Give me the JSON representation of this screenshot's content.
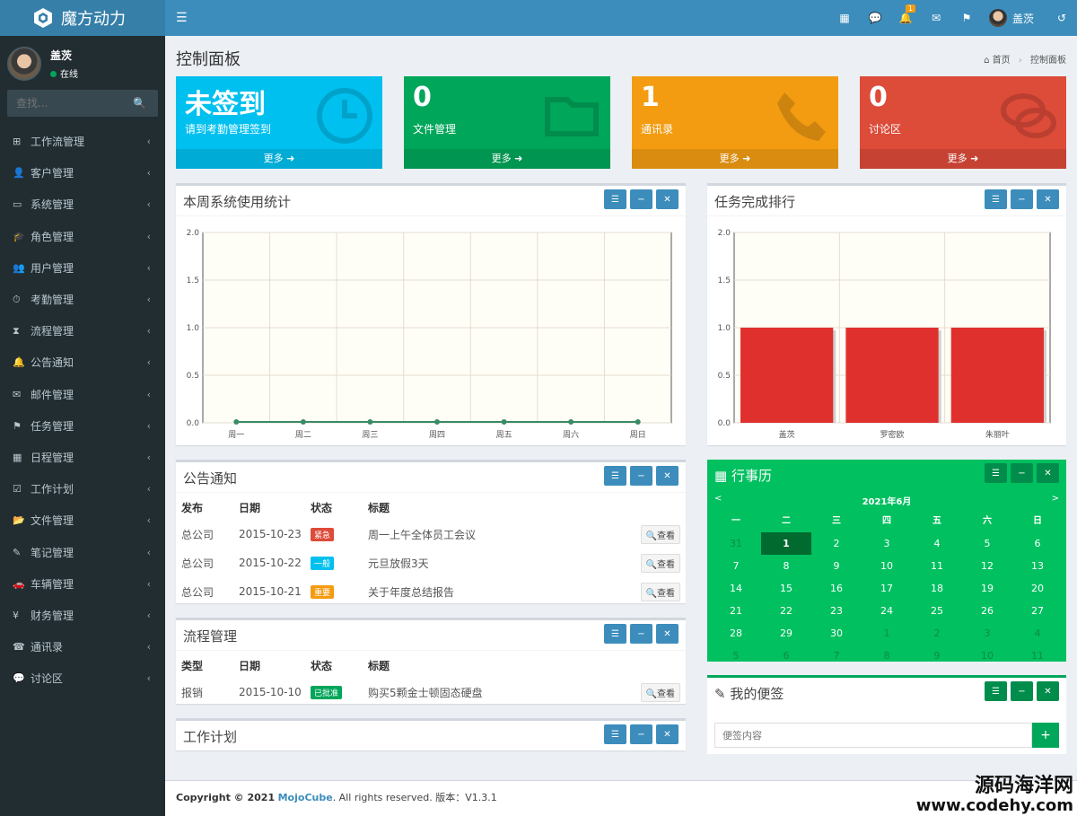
{
  "app": {
    "title": "魔方动力"
  },
  "topbar": {
    "notification_count": "1",
    "username": "盖茨"
  },
  "user": {
    "name": "盖茨",
    "status": "在线"
  },
  "search": {
    "placeholder": "查找..."
  },
  "sidebar": {
    "items": [
      {
        "label": "工作流管理",
        "icon": "sitemap-icon"
      },
      {
        "label": "客户管理",
        "icon": "user-icon"
      },
      {
        "label": "系统管理",
        "icon": "desktop-icon"
      },
      {
        "label": "角色管理",
        "icon": "graduation-cap-icon"
      },
      {
        "label": "用户管理",
        "icon": "users-icon"
      },
      {
        "label": "考勤管理",
        "icon": "clock-icon"
      },
      {
        "label": "流程管理",
        "icon": "hourglass-icon"
      },
      {
        "label": "公告通知",
        "icon": "bell-icon"
      },
      {
        "label": "邮件管理",
        "icon": "envelope-icon"
      },
      {
        "label": "任务管理",
        "icon": "flag-icon"
      },
      {
        "label": "日程管理",
        "icon": "calendar-icon"
      },
      {
        "label": "工作计划",
        "icon": "calendar-check-icon"
      },
      {
        "label": "文件管理",
        "icon": "folder-open-icon"
      },
      {
        "label": "笔记管理",
        "icon": "edit-icon"
      },
      {
        "label": "车辆管理",
        "icon": "car-icon"
      },
      {
        "label": "财务管理",
        "icon": "yen-icon"
      },
      {
        "label": "通讯录",
        "icon": "phone-icon"
      },
      {
        "label": "讨论区",
        "icon": "comments-icon"
      }
    ]
  },
  "page": {
    "title": "控制面板",
    "breadcrumb_home": "首页",
    "breadcrumb_current": "控制面板"
  },
  "stat_boxes": [
    {
      "value": "未签到",
      "label": "请到考勤管理签到",
      "more": "更多",
      "color": "#00c0ef",
      "icon": "clock-icon"
    },
    {
      "value": "0",
      "label": "文件管理",
      "more": "更多",
      "color": "#00a65a",
      "icon": "folder-open-icon"
    },
    {
      "value": "1",
      "label": "通讯录",
      "more": "更多",
      "color": "#f39c12",
      "icon": "phone-icon"
    },
    {
      "value": "0",
      "label": "讨论区",
      "more": "更多",
      "color": "#dd4b39",
      "icon": "comments-icon"
    }
  ],
  "panels": {
    "usage_title": "本周系统使用统计",
    "ranking_title": "任务完成排行",
    "notice_title": "公告通知",
    "process_title": "流程管理",
    "plan_title": "工作计划",
    "calendar_title": "行事历",
    "note_title": "我的便签"
  },
  "chart_data": [
    {
      "type": "line",
      "categories": [
        "周一",
        "周二",
        "周三",
        "周四",
        "周五",
        "周六",
        "周日"
      ],
      "values": [
        0,
        0,
        0,
        0,
        0,
        0,
        0
      ],
      "ylim": [
        0,
        2.0
      ],
      "yticks": [
        "0.0",
        "0.5",
        "1.0",
        "1.5",
        "2.0"
      ],
      "grid": true,
      "color": "#3a8a66"
    },
    {
      "type": "bar",
      "categories": [
        "盖茨",
        "罗密欧",
        "朱丽叶"
      ],
      "values": [
        1,
        1,
        1
      ],
      "ylim": [
        0,
        2.0
      ],
      "yticks": [
        "0.0",
        "0.5",
        "1.0",
        "1.5",
        "2.0"
      ],
      "grid": true,
      "color": "#e0302d"
    }
  ],
  "notice_table": {
    "headers": [
      "发布",
      "日期",
      "状态",
      "标题"
    ],
    "rows": [
      {
        "publisher": "总公司",
        "date": "2015-10-23",
        "status": "紧急",
        "status_color": "#dd4b39",
        "title": "周一上午全体员工会议",
        "action": "查看"
      },
      {
        "publisher": "总公司",
        "date": "2015-10-22",
        "status": "一般",
        "status_color": "#00c0ef",
        "title": "元旦放假3天",
        "action": "查看"
      },
      {
        "publisher": "总公司",
        "date": "2015-10-21",
        "status": "重要",
        "status_color": "#f39c12",
        "title": "关于年度总结报告",
        "action": "查看"
      }
    ]
  },
  "process_table": {
    "headers": [
      "类型",
      "日期",
      "状态",
      "标题"
    ],
    "rows": [
      {
        "type": "报销",
        "date": "2015-10-10",
        "status": "已批准",
        "status_color": "#00a65a",
        "title": "购买5颗金士顿固态硬盘",
        "action": "查看"
      }
    ]
  },
  "calendar": {
    "month": "2021年6月",
    "prev": "<",
    "next": ">",
    "weekdays": [
      "一",
      "二",
      "三",
      "四",
      "五",
      "六",
      "日"
    ],
    "weeks": [
      [
        "31",
        "1",
        "2",
        "3",
        "4",
        "5",
        "6"
      ],
      [
        "7",
        "8",
        "9",
        "10",
        "11",
        "12",
        "13"
      ],
      [
        "14",
        "15",
        "16",
        "17",
        "18",
        "19",
        "20"
      ],
      [
        "21",
        "22",
        "23",
        "24",
        "25",
        "26",
        "27"
      ],
      [
        "28",
        "29",
        "30",
        "1",
        "2",
        "3",
        "4"
      ],
      [
        "5",
        "6",
        "7",
        "8",
        "9",
        "10",
        "11"
      ]
    ],
    "today": "1"
  },
  "note": {
    "placeholder": "便签内容",
    "add": "+"
  },
  "footer": {
    "copyright": "Copyright © 2021",
    "brand": "MojoCube",
    "rights": ". All rights reserved. 版本：V1.3.1"
  },
  "watermark": {
    "line1": "源码海洋网",
    "line2": "www.codehy.com"
  }
}
